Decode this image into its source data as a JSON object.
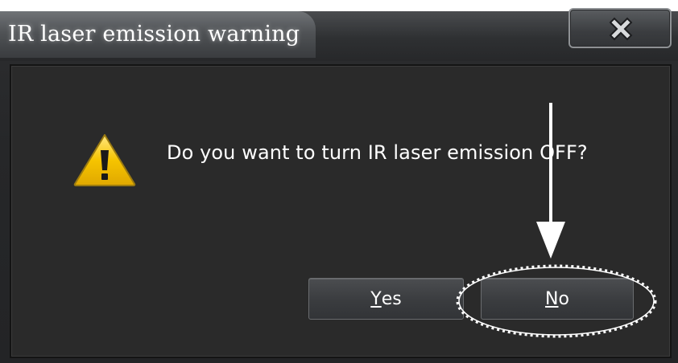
{
  "window": {
    "title": "IR laser emission warning",
    "close_icon": "close-icon"
  },
  "dialog": {
    "icon": "warning-icon",
    "message": "Do you want to turn IR laser emission OFF?"
  },
  "buttons": {
    "yes": {
      "mnemonic": "Y",
      "rest": "es"
    },
    "no": {
      "mnemonic": "N",
      "rest": "o"
    }
  },
  "annotation": {
    "icons": [
      "arrow-down-icon",
      "ellipse-highlight"
    ]
  },
  "colors": {
    "background": "#2a2a2a",
    "text": "#ffffff",
    "warning_yellow": "#f2c200",
    "annotation": "#ffffff"
  }
}
